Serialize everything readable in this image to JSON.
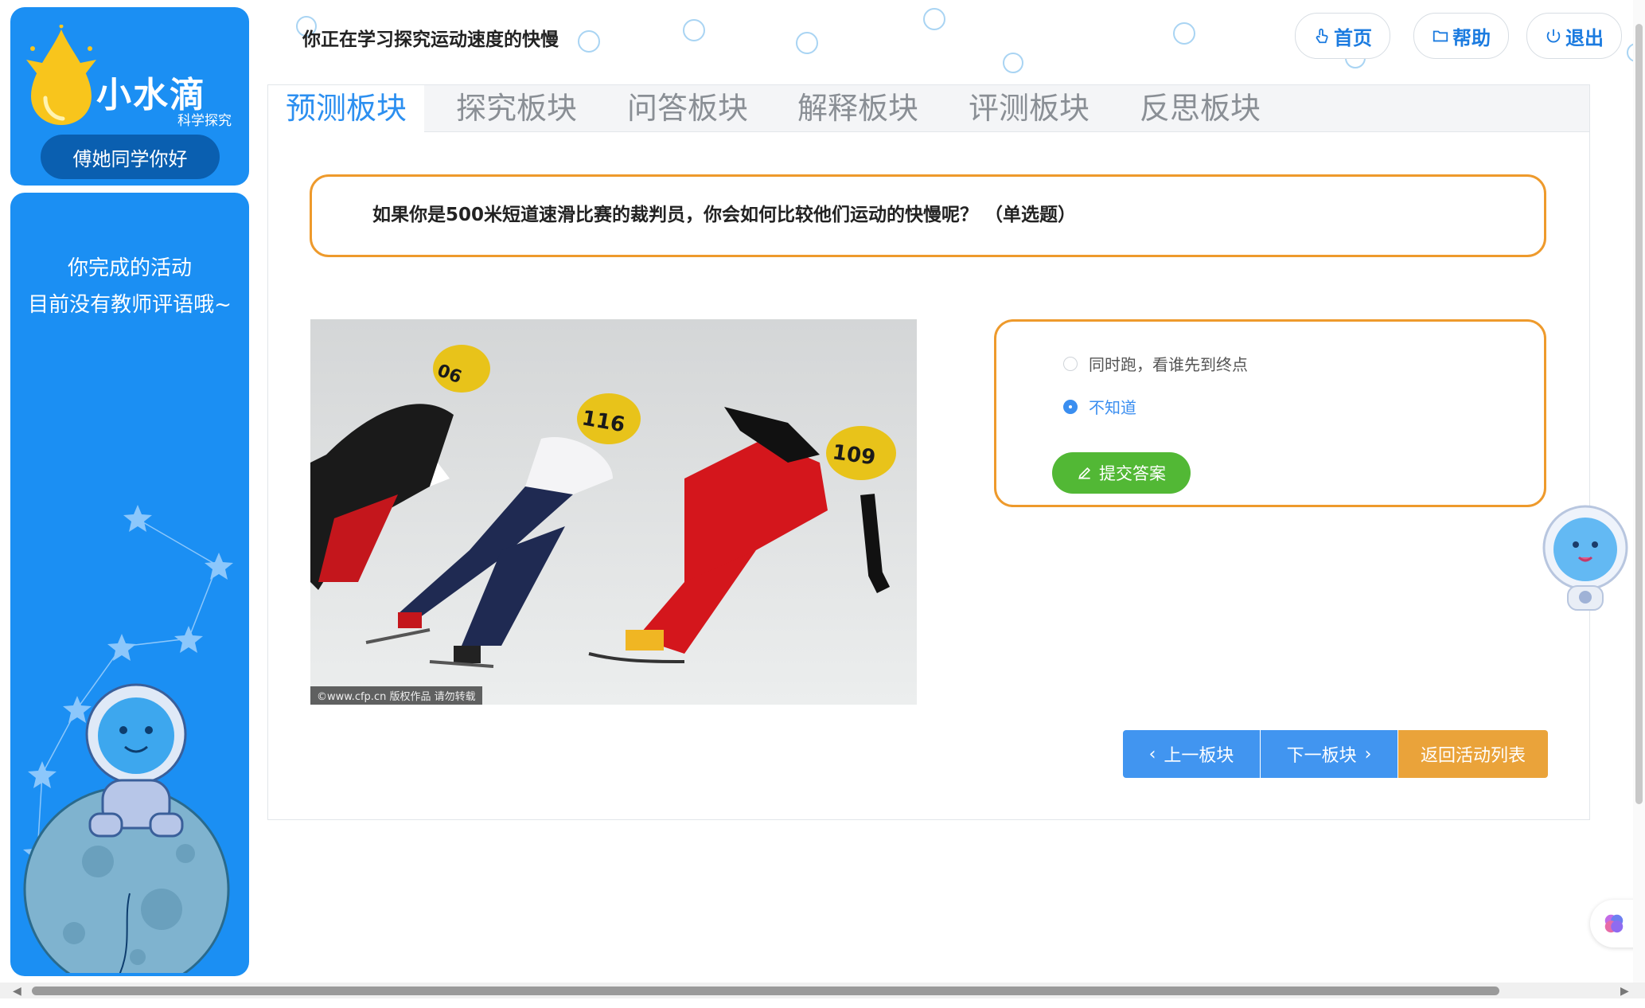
{
  "app": {
    "logo_text": "小水滴",
    "logo_subtitle": "科学探究",
    "greeting": "傅她同学你好",
    "teacher_message_line1": "你完成的活动",
    "teacher_message_line2": "目前没有教师评语哦~",
    "page_title": "你正在学习探究运动速度的快慢"
  },
  "header_buttons": {
    "home": "首页",
    "help": "帮助",
    "logout": "退出"
  },
  "tabs": [
    {
      "label": "预测板块",
      "active": true
    },
    {
      "label": "探究板块",
      "active": false
    },
    {
      "label": "问答板块",
      "active": false
    },
    {
      "label": "解释板块",
      "active": false
    },
    {
      "label": "评测板块",
      "active": false
    },
    {
      "label": "反思板块",
      "active": false
    }
  ],
  "question": {
    "text": "如果你是500米短道速滑比赛的裁判员，你会如何比较他们运动的快慢呢？ （单选题）"
  },
  "photo": {
    "credit": "©www.cfp.cn 版权作品 请勿转载",
    "helmet_numbers": [
      "06",
      "116",
      "109"
    ]
  },
  "options": [
    {
      "label": "同时跑，看谁先到终点",
      "checked": false
    },
    {
      "label": "不知道",
      "checked": true
    }
  ],
  "submit_label": "提交答案",
  "nav": {
    "prev": "上一板块",
    "next": "下一板块",
    "back": "返回活动列表"
  },
  "colors": {
    "sidebar": "#1b8ff3",
    "accent_blue": "#2c8ff0",
    "border_orange": "#ee9a2c",
    "submit_green": "#52b835",
    "back_orange": "#eaa33a"
  }
}
